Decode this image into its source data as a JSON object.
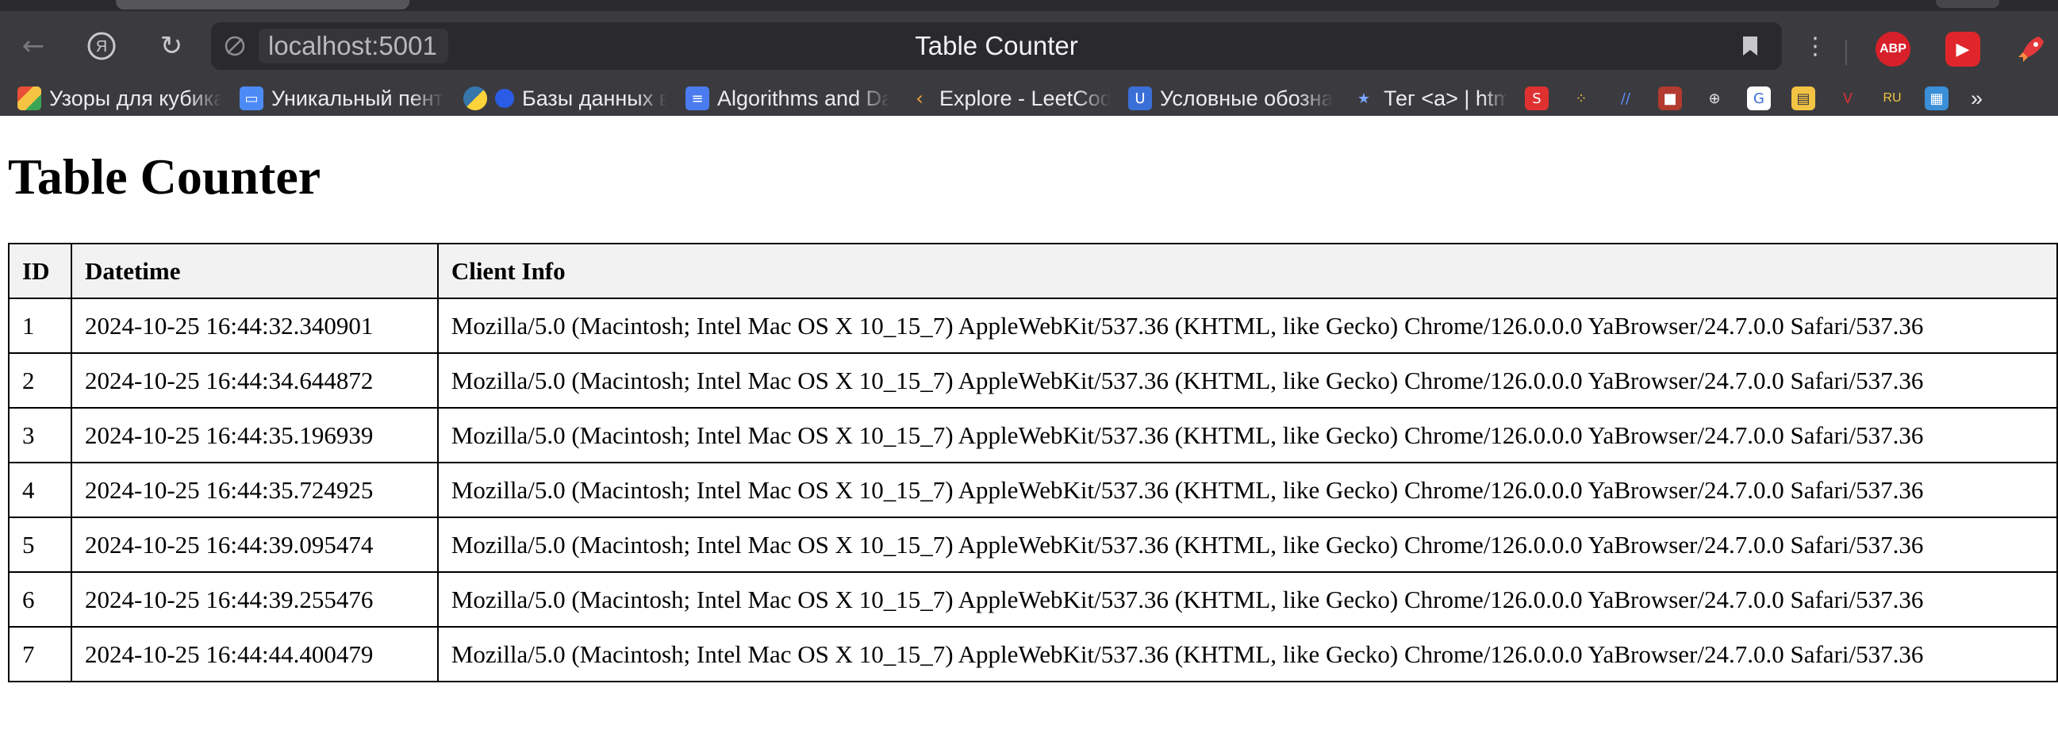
{
  "browser": {
    "address_url": "localhost:5001",
    "page_title": "Table Counter",
    "bookmarks": [
      {
        "label": "Узоры для кубика",
        "icon": "cube-icon"
      },
      {
        "label": "Уникальный пентальный",
        "icon": "folder-icon"
      },
      {
        "label": "Базы данных в",
        "icon": "python-icon"
      },
      {
        "label": "Algorithms and Data",
        "icon": "document-icon"
      },
      {
        "label": "Explore - LeetCode",
        "icon": "leetcode-icon"
      },
      {
        "label": "Условные обозначения",
        "icon": "shield-icon"
      },
      {
        "label": "Тег <a> | html",
        "icon": "star-icon"
      }
    ],
    "bookmark_icons_only": [
      "s-icon",
      "dots-icon",
      "slash-icon",
      "square-icon",
      "globe-icon",
      "circle-icon",
      "book-icon",
      "v-icon",
      "r-icon",
      "grid-icon"
    ],
    "overflow_label": "»",
    "extensions": {
      "adblock_label": "ABP",
      "youtube_icon": "play-icon",
      "rocket_icon": "rocket-icon"
    }
  },
  "page": {
    "heading": "Table Counter",
    "table": {
      "headers": [
        "ID",
        "Datetime",
        "Client Info"
      ],
      "rows": [
        [
          "1",
          "2024-10-25 16:44:32.340901",
          "Mozilla/5.0 (Macintosh; Intel Mac OS X 10_15_7) AppleWebKit/537.36 (KHTML, like Gecko) Chrome/126.0.0.0 YaBrowser/24.7.0.0 Safari/537.36"
        ],
        [
          "2",
          "2024-10-25 16:44:34.644872",
          "Mozilla/5.0 (Macintosh; Intel Mac OS X 10_15_7) AppleWebKit/537.36 (KHTML, like Gecko) Chrome/126.0.0.0 YaBrowser/24.7.0.0 Safari/537.36"
        ],
        [
          "3",
          "2024-10-25 16:44:35.196939",
          "Mozilla/5.0 (Macintosh; Intel Mac OS X 10_15_7) AppleWebKit/537.36 (KHTML, like Gecko) Chrome/126.0.0.0 YaBrowser/24.7.0.0 Safari/537.36"
        ],
        [
          "4",
          "2024-10-25 16:44:35.724925",
          "Mozilla/5.0 (Macintosh; Intel Mac OS X 10_15_7) AppleWebKit/537.36 (KHTML, like Gecko) Chrome/126.0.0.0 YaBrowser/24.7.0.0 Safari/537.36"
        ],
        [
          "5",
          "2024-10-25 16:44:39.095474",
          "Mozilla/5.0 (Macintosh; Intel Mac OS X 10_15_7) AppleWebKit/537.36 (KHTML, like Gecko) Chrome/126.0.0.0 YaBrowser/24.7.0.0 Safari/537.36"
        ],
        [
          "6",
          "2024-10-25 16:44:39.255476",
          "Mozilla/5.0 (Macintosh; Intel Mac OS X 10_15_7) AppleWebKit/537.36 (KHTML, like Gecko) Chrome/126.0.0.0 YaBrowser/24.7.0.0 Safari/537.36"
        ],
        [
          "7",
          "2024-10-25 16:44:44.400479",
          "Mozilla/5.0 (Macintosh; Intel Mac OS X 10_15_7) AppleWebKit/537.36 (KHTML, like Gecko) Chrome/126.0.0.0 YaBrowser/24.7.0.0 Safari/537.36"
        ]
      ]
    }
  }
}
